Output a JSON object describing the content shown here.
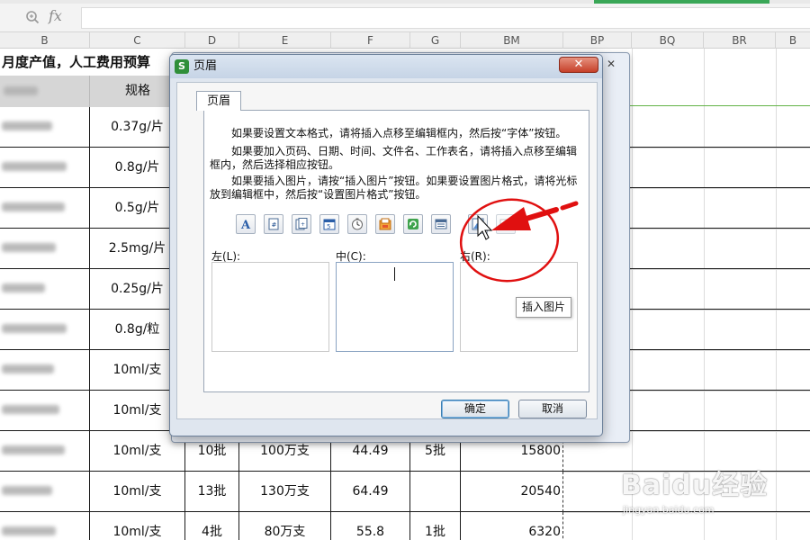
{
  "formula_bar": {
    "fx_label": "fx",
    "value": ""
  },
  "columns": [
    {
      "id": "B"
    },
    {
      "id": "C"
    },
    {
      "id": "D"
    },
    {
      "id": "E"
    },
    {
      "id": "F"
    },
    {
      "id": "G"
    },
    {
      "id": "BM"
    },
    {
      "id": "BP"
    },
    {
      "id": "BQ"
    },
    {
      "id": "BR"
    },
    {
      "id": "B"
    }
  ],
  "sheet": {
    "title": "月度产值，人工费用预算",
    "spec_header": "规格",
    "rows": [
      {
        "spec": "0.37g/片"
      },
      {
        "spec": "0.8g/片"
      },
      {
        "spec": "0.5g/片"
      },
      {
        "spec": "2.5mg/片"
      },
      {
        "spec": "0.25g/片"
      },
      {
        "spec": "0.8g/粒"
      },
      {
        "spec": "10ml/支"
      },
      {
        "spec": "10ml/支"
      },
      {
        "spec": "10ml/支",
        "d": "10批",
        "e": "100万支",
        "f": "44.49",
        "g": "5批",
        "bm": "15800"
      },
      {
        "spec": "10ml/支",
        "d": "13批",
        "e": "130万支",
        "f": "64.49",
        "g": "",
        "bm": "20540"
      },
      {
        "spec": "10ml/支",
        "d": "4批",
        "e": "80万支",
        "f": "55.8",
        "g": "1批",
        "bm": "6320"
      }
    ]
  },
  "dialog": {
    "title": "页眉",
    "close_label": "✕",
    "tab_label": "页眉",
    "instructions": {
      "p1": "如果要设置文本格式，请将插入点移至编辑框内，然后按“字体”按钮。",
      "p2": "如果要加入页码、日期、时间、文件名、工作表名，请将插入点移至编辑框内，然后选择相应按钮。",
      "p3": "如果要插入图片，请按“插入图片”按钮。如果要设置图片格式，请将光标放到编辑框中，然后按“设置图片格式”按钮。"
    },
    "toolbar": [
      {
        "icon": "font-icon"
      },
      {
        "icon": "page-number-icon"
      },
      {
        "icon": "page-count-icon"
      },
      {
        "icon": "date-icon"
      },
      {
        "icon": "time-icon"
      },
      {
        "icon": "file-path-icon"
      },
      {
        "icon": "filename-icon"
      },
      {
        "icon": "sheet-name-icon"
      },
      {
        "icon": "insert-picture-icon"
      },
      {
        "icon": "format-picture-icon"
      }
    ],
    "tooltip": "插入图片",
    "left_label": "左(L):",
    "center_label": "中(C):",
    "right_label": "右(R):",
    "ok_label": "确定",
    "cancel_label": "取消"
  },
  "watermark": {
    "logo": "Baidu经验",
    "url": "jingyan.baidu.com"
  },
  "colors": {
    "annotation_red": "#e01010",
    "wps_green": "#2f8f3a"
  }
}
